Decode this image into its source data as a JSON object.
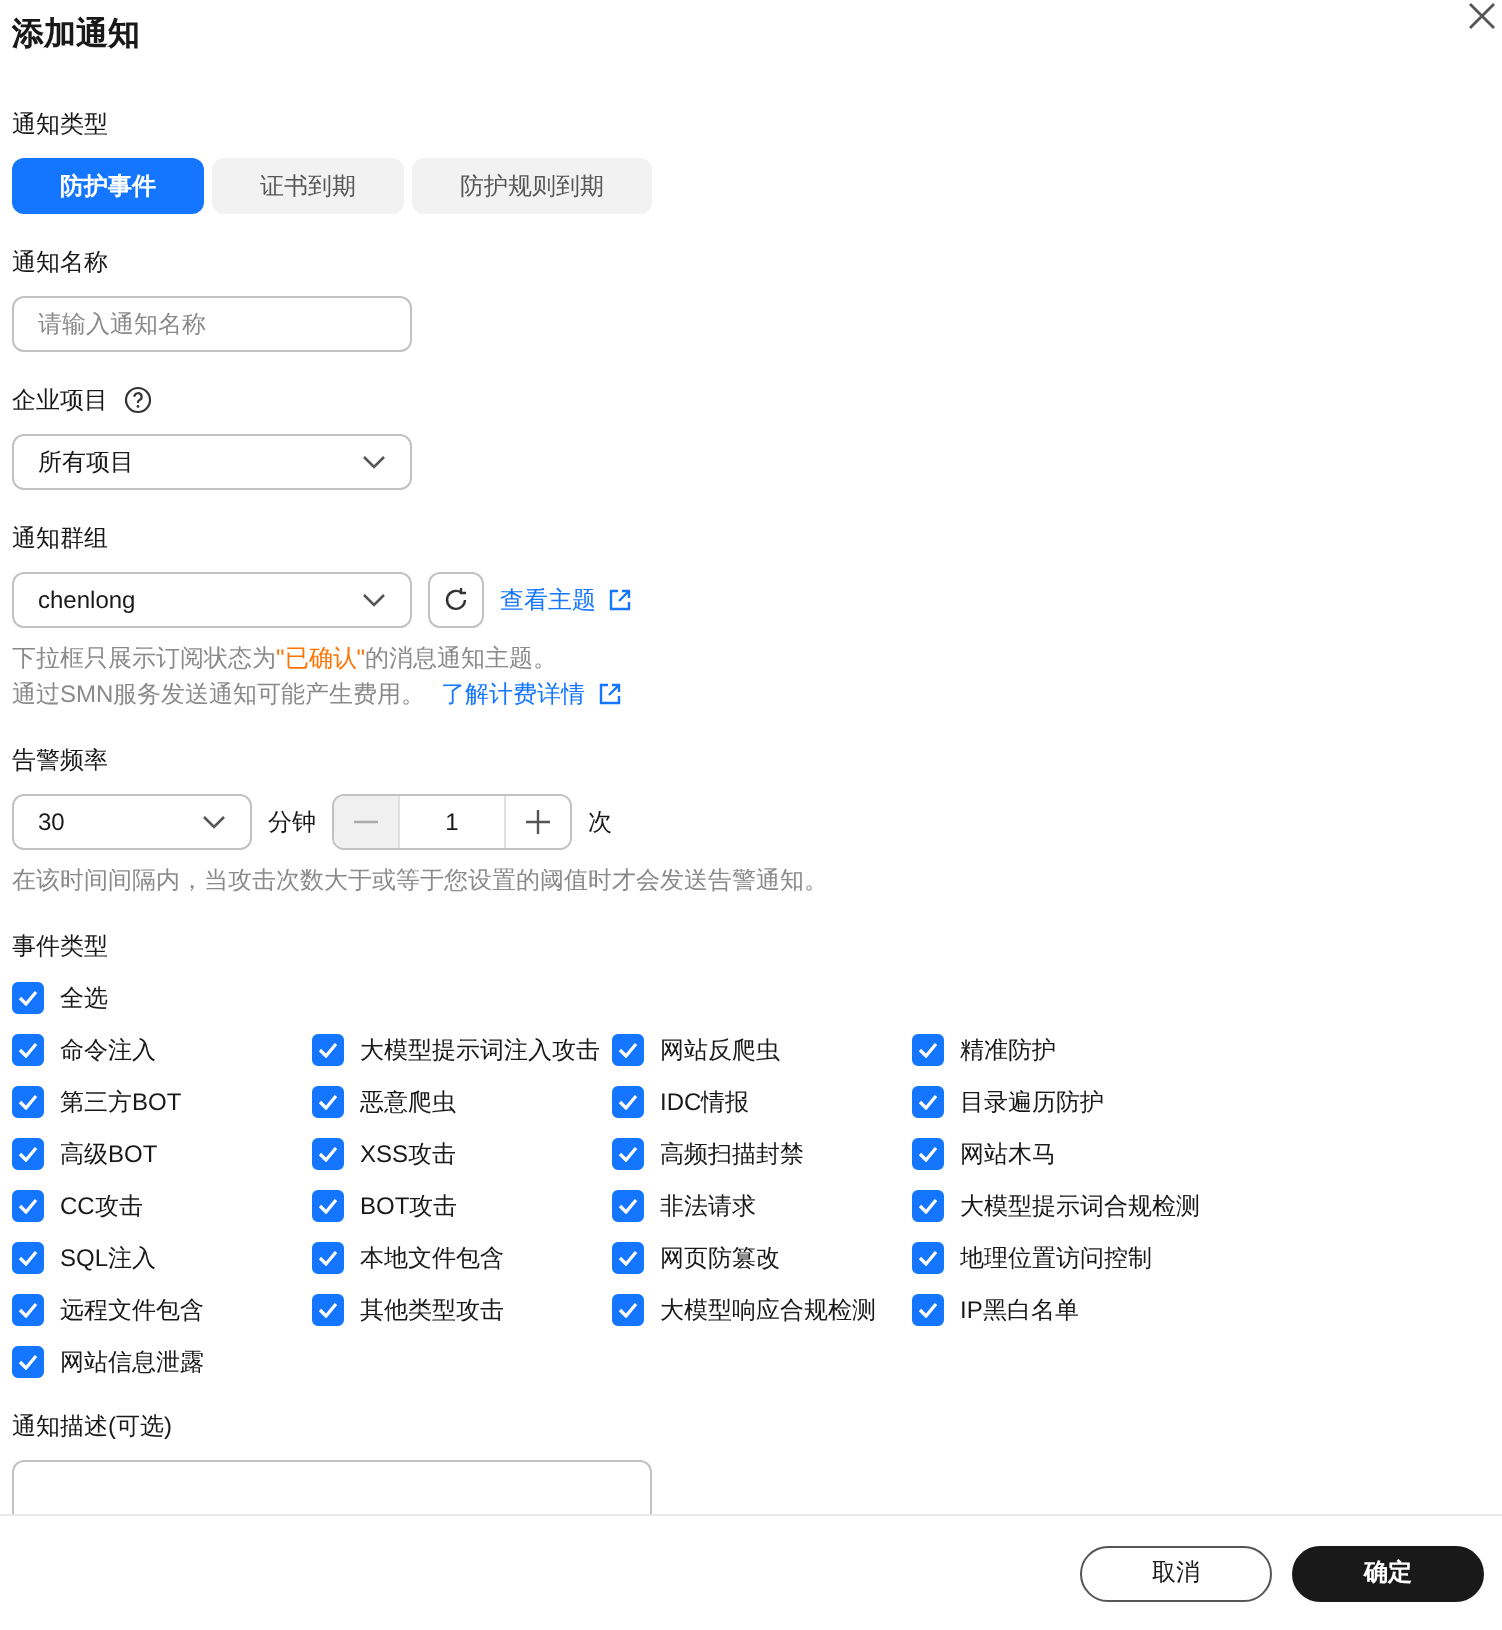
{
  "dialog": {
    "title": "添加通知"
  },
  "notice_type": {
    "label": "通知类型",
    "options": [
      {
        "label": "防护事件",
        "selected": true
      },
      {
        "label": "证书到期",
        "selected": false
      },
      {
        "label": "防护规则到期",
        "selected": false
      }
    ]
  },
  "notice_name": {
    "label": "通知名称",
    "placeholder": "请输入通知名称"
  },
  "enterprise_project": {
    "label": "企业项目",
    "value": "所有项目"
  },
  "notice_group": {
    "label": "通知群组",
    "value": "chenlong",
    "link": "查看主题",
    "hint_1": {
      "prefix": "下拉框只展示订阅状态为",
      "highlight": "\"已确认\"",
      "suffix": "的消息通知主题。"
    },
    "hint_2": "通过SMN服务发送通知可能产生费用。",
    "hint_link": "了解计费详情"
  },
  "alarm_frequency": {
    "label": "告警频率",
    "interval": "30",
    "interval_unit": "分钟",
    "count": "1",
    "count_unit": "次",
    "hint": "在该时间间隔内，当攻击次数大于或等于您设置的阈值时才会发送告警通知。"
  },
  "event_types": {
    "label": "事件类型",
    "select_all": {
      "label": "全选",
      "checked": true
    },
    "items": [
      {
        "label": "命令注入",
        "checked": true
      },
      {
        "label": "大模型提示词注入攻击",
        "checked": true
      },
      {
        "label": "网站反爬虫",
        "checked": true
      },
      {
        "label": "精准防护",
        "checked": true
      },
      {
        "label": "第三方BOT",
        "checked": true
      },
      {
        "label": "恶意爬虫",
        "checked": true
      },
      {
        "label": "IDC情报",
        "checked": true
      },
      {
        "label": "目录遍历防护",
        "checked": true
      },
      {
        "label": "高级BOT",
        "checked": true
      },
      {
        "label": "XSS攻击",
        "checked": true
      },
      {
        "label": "高频扫描封禁",
        "checked": true
      },
      {
        "label": "网站木马",
        "checked": true
      },
      {
        "label": "CC攻击",
        "checked": true
      },
      {
        "label": "BOT攻击",
        "checked": true
      },
      {
        "label": "非法请求",
        "checked": true
      },
      {
        "label": "大模型提示词合规检测",
        "checked": true
      },
      {
        "label": "SQL注入",
        "checked": true
      },
      {
        "label": "本地文件包含",
        "checked": true
      },
      {
        "label": "网页防篡改",
        "checked": true
      },
      {
        "label": "地理位置访问控制",
        "checked": true
      },
      {
        "label": "远程文件包含",
        "checked": true
      },
      {
        "label": "其他类型攻击",
        "checked": true
      },
      {
        "label": "大模型响应合规检测",
        "checked": true
      },
      {
        "label": "IP黑白名单",
        "checked": true
      },
      {
        "label": "网站信息泄露",
        "checked": true
      }
    ]
  },
  "description": {
    "label": "通知描述(可选)"
  },
  "buttons": [
    {
      "label": "取消",
      "kind": "secondary"
    },
    {
      "label": "确定",
      "kind": "primary"
    }
  ]
}
